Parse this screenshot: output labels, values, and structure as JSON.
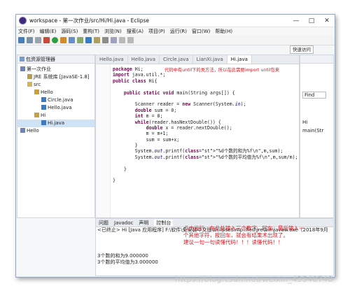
{
  "window": {
    "title": "workspace - 第一次作业/src/Hi/Hi.java - Eclipse"
  },
  "menu": [
    "文件(F)",
    "编辑(E)",
    "源码(S)",
    "重构(T)",
    "浏览(N)",
    "搜索(A)",
    "项目(P)",
    "运行(R)",
    "窗口(W)",
    "帮助(H)"
  ],
  "quick_access": "快速访问",
  "package_explorer": {
    "title": "包资源管理器",
    "tree": [
      {
        "label": "第一次作业",
        "indent": 0,
        "icon": "project"
      },
      {
        "label": "JRE 系统库 [JavaSE-1.8]",
        "indent": 1,
        "icon": "library"
      },
      {
        "label": "src",
        "indent": 1,
        "icon": "folder"
      },
      {
        "label": "Hello",
        "indent": 2,
        "icon": "package"
      },
      {
        "label": "Circle.java",
        "indent": 3,
        "icon": "java"
      },
      {
        "label": "Hello.java",
        "indent": 3,
        "icon": "java"
      },
      {
        "label": "Hi",
        "indent": 2,
        "icon": "package"
      },
      {
        "label": "Hi.java",
        "indent": 3,
        "icon": "java",
        "selected": true
      },
      {
        "label": "Hello",
        "indent": 0,
        "icon": "project"
      }
    ]
  },
  "editor": {
    "tabs": [
      "Hello.java",
      "Hello.java",
      "Circle.java",
      "LianXi.java",
      "Hi.java"
    ],
    "active_tab": 4,
    "annotation": "代码中有until下的类方法，所以在此需要import until包来",
    "code": [
      "package Hi;",
      "import java.util.*;",
      "public class Hi{",
      "",
      "    public static void main(String args[]) {",
      "",
      "        Scanner reader = new Scanner(System.in);",
      "        double sum = 0;",
      "        int m = 0;",
      "        while(reader.hasNextDouble()) {",
      "            double x = reader.nextDouble();",
      "            m = m+1;",
      "            sum = sum+x;",
      "        }",
      "        System.out.printf(\"%d个数的和为%f\\n\",m,sum);",
      "        System.out.printf(\"%d个数的平均值为%f\\n\",m,sum/m);",
      "",
      "    }",
      "",
      "}"
    ]
  },
  "right_panel": {
    "find_label": "Find",
    "item": "main(Str",
    "class_label": "Hi"
  },
  "console": {
    "tabs": [
      "问题",
      "Javadoc",
      "声明",
      "控制台"
    ],
    "active_tab": 3,
    "header": "<已终止> Hi [Java 应用程序] F:\\软件\\免安装中文版\\EclipseSimplified\\jre\\bin\\javaw.exe（2018年9月",
    "output": [
      "3个数的和为9.000000",
      "3个数的平均值为3.000000"
    ]
  },
  "note": [
    "点击运行，在此处输入三个数字，回车，最后输入一",
    "个其他字符，按回车，就会有结果术出现了。",
    "建议一句一句读懂代码！！！读懂代码！！"
  ],
  "watermark": "https://blog.csdn.net/weixin_43548748"
}
